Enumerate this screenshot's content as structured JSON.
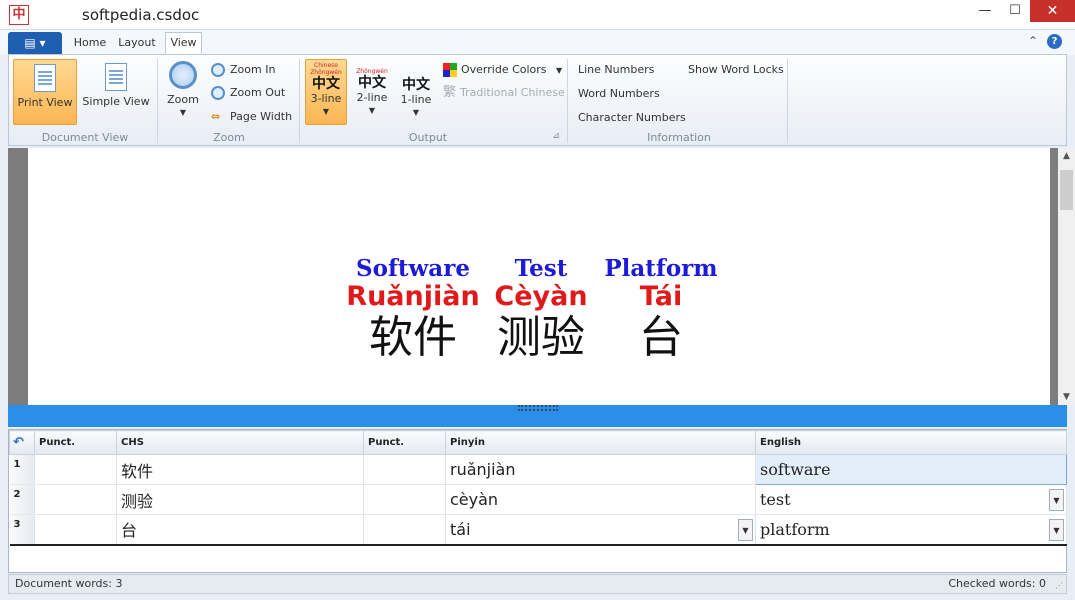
{
  "window": {
    "title": "softpedia.csdoc",
    "minimize": "—",
    "maximize": "☐",
    "close": "✕",
    "app_icon": "中"
  },
  "ribbon_tabs": {
    "file": "▤ ▾",
    "home": "Home",
    "layout": "Layout",
    "view": "View",
    "collapse": "⌃",
    "help": "?"
  },
  "groups": {
    "document_view": {
      "label": "Document View",
      "print_view": "Print View",
      "simple_view": "Simple View"
    },
    "zoom": {
      "label": "Zoom",
      "zoom": "Zoom",
      "zoom_in": "Zoom In",
      "zoom_out": "Zoom Out",
      "page_width": "Page Width"
    },
    "output": {
      "label": "Output",
      "three_line_tiny_en": "Chinese",
      "three_line_tiny_py": "Zhōngwén",
      "three_line_cn": "中文",
      "three_line": "3-line",
      "two_line_tiny_py": "Zhōngwén",
      "two_line_cn": "中文",
      "two_line": "2-line",
      "one_line_cn": "中文",
      "one_line": "1-line",
      "override_colors": "Override Colors",
      "traditional_glyph": "繁",
      "traditional_chinese": "Traditional Chinese",
      "launcher": "⊿"
    },
    "information": {
      "label": "Information",
      "line_numbers": "Line Numbers",
      "word_numbers": "Word Numbers",
      "character_numbers": "Character Numbers",
      "show_word_locks": "Show Word Locks"
    }
  },
  "document": {
    "words": [
      {
        "english": "Software",
        "pinyin": "Ruǎnjiàn",
        "chinese": "软件"
      },
      {
        "english": "Test",
        "pinyin": "Cèyàn",
        "chinese": "测验"
      },
      {
        "english": "Platform",
        "pinyin": "Tái",
        "chinese": "台"
      }
    ]
  },
  "grid": {
    "headers": {
      "punct1": "Punct.",
      "chs": "CHS",
      "punct2": "Punct.",
      "pinyin": "Pinyin",
      "english": "English"
    },
    "rows": [
      {
        "num": "1",
        "punct1": "",
        "chs": "软件",
        "punct2": "",
        "pinyin": "ruǎnjiàn",
        "english": "software"
      },
      {
        "num": "2",
        "punct1": "",
        "chs": "测验",
        "punct2": "",
        "pinyin": "cèyàn",
        "english": "test"
      },
      {
        "num": "3",
        "punct1": "",
        "chs": "台",
        "punct2": "",
        "pinyin": "tái",
        "english": "platform"
      }
    ]
  },
  "status": {
    "document_words": "Document words: 3",
    "checked_words": "Checked words: 0"
  },
  "colors": {
    "english": "#1c1cd6",
    "pinyin": "#e01a1a",
    "chinese": "#111111",
    "splitter": "#2b8fe8",
    "active_button": "#fbb652"
  }
}
